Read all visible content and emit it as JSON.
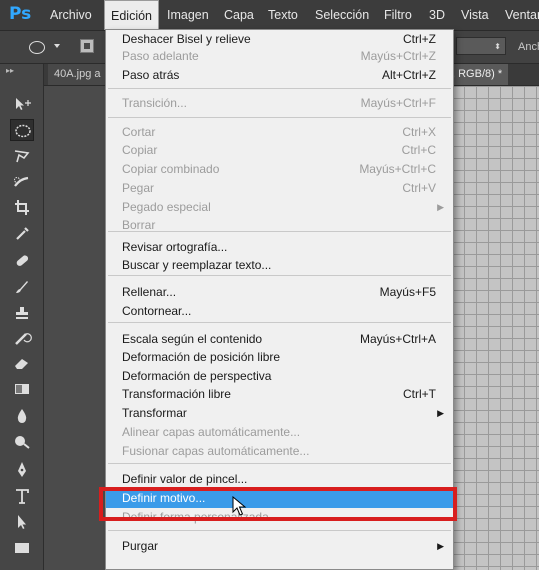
{
  "app": {
    "logo": "Ps",
    "accent": "#31a8ff"
  },
  "menubar": {
    "items": [
      "Archivo",
      "Edición",
      "Imagen",
      "Capa",
      "Texto",
      "Selección",
      "Filtro",
      "3D",
      "Vista",
      "Ventana"
    ],
    "active": "Edición"
  },
  "options": {
    "right_text": "Anch"
  },
  "tabs": {
    "left": "40A.jpg a",
    "right": ", RGB/8) *"
  },
  "dropdown": {
    "items": [
      {
        "label": "Deshacer Bisel y relieve",
        "shortcut": "Ctrl+Z",
        "enabled": true
      },
      {
        "label": "Paso adelante",
        "shortcut": "Mayús+Ctrl+Z",
        "enabled": false
      },
      {
        "label": "Paso atrás",
        "shortcut": "Alt+Ctrl+Z",
        "enabled": true
      },
      {
        "label": "Transición...",
        "shortcut": "Mayús+Ctrl+F",
        "enabled": false
      },
      {
        "label": "Cortar",
        "shortcut": "Ctrl+X",
        "enabled": false
      },
      {
        "label": "Copiar",
        "shortcut": "Ctrl+C",
        "enabled": false
      },
      {
        "label": "Copiar combinado",
        "shortcut": "Mayús+Ctrl+C",
        "enabled": false
      },
      {
        "label": "Pegar",
        "shortcut": "Ctrl+V",
        "enabled": false
      },
      {
        "label": "Pegado especial",
        "shortcut": "",
        "enabled": false,
        "submenu": true
      },
      {
        "label": "Borrar",
        "shortcut": "",
        "enabled": false
      },
      {
        "label": "Revisar ortografía...",
        "shortcut": "",
        "enabled": true
      },
      {
        "label": "Buscar y reemplazar texto...",
        "shortcut": "",
        "enabled": true
      },
      {
        "label": "Rellenar...",
        "shortcut": "Mayús+F5",
        "enabled": true
      },
      {
        "label": "Contornear...",
        "shortcut": "",
        "enabled": true
      },
      {
        "label": "Escala según el contenido",
        "shortcut": "Mayús+Ctrl+A",
        "enabled": true
      },
      {
        "label": "Deformación de posición libre",
        "shortcut": "",
        "enabled": true
      },
      {
        "label": "Deformación de perspectiva",
        "shortcut": "",
        "enabled": true
      },
      {
        "label": "Transformación libre",
        "shortcut": "Ctrl+T",
        "enabled": true
      },
      {
        "label": "Transformar",
        "shortcut": "",
        "enabled": true,
        "submenu": true
      },
      {
        "label": "Alinear capas automáticamente...",
        "shortcut": "",
        "enabled": false
      },
      {
        "label": "Fusionar capas automáticamente...",
        "shortcut": "",
        "enabled": false
      },
      {
        "label": "Definir valor de pincel...",
        "shortcut": "",
        "enabled": true
      },
      {
        "label": "Definir motivo...",
        "shortcut": "",
        "enabled": true,
        "highlighted": true
      },
      {
        "label": "Definir forma personalizada...",
        "shortcut": "",
        "enabled": false
      },
      {
        "label": "Purgar",
        "shortcut": "",
        "enabled": true,
        "submenu": true
      }
    ],
    "highlight_color": "#3b9be9",
    "callout_color": "#d81e1e"
  },
  "toolbar": {
    "tools": [
      "move-tool-icon",
      "elliptical-marquee-icon",
      "lasso-icon",
      "quick-selection-icon",
      "crop-icon",
      "eyedropper-icon",
      "spot-healing-icon",
      "brush-icon",
      "clone-stamp-icon",
      "history-brush-icon",
      "eraser-icon",
      "gradient-icon",
      "blur-icon",
      "dodge-icon",
      "pen-icon",
      "type-icon",
      "path-selection-icon",
      "rectangle-shape-icon"
    ],
    "selected": "elliptical-marquee-icon"
  }
}
